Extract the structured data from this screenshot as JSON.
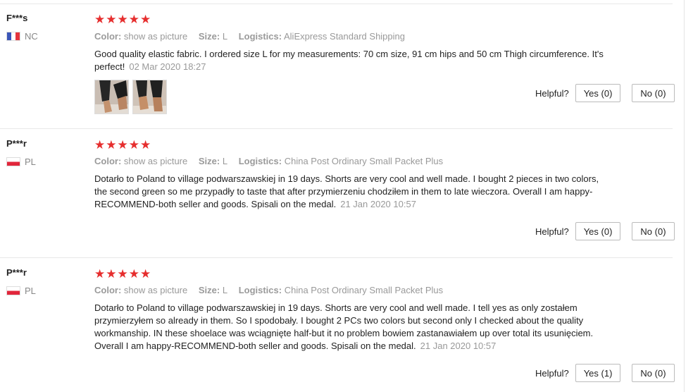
{
  "reviews": [
    {
      "user": "F***s",
      "country": "NC",
      "rating_stars": 5,
      "stars": "★★★★★",
      "color_label": "Color:",
      "color_value": "show as picture",
      "size_label": "Size:",
      "size_value": "L",
      "logistics_label": "Logistics:",
      "logistics_value": "AliExpress Standard Shipping",
      "text": "Good quality elastic fabric. I ordered size L for my measurements: 70 cm size, 91 cm hips and 50 cm Thigh circumference. It's perfect!",
      "date": "02 Mar 2020 18:27",
      "helpful_label": "Helpful?",
      "yes_label": "Yes (0)",
      "no_label": "No (0)"
    },
    {
      "user": "P***r",
      "country": "PL",
      "rating_stars": 5,
      "stars": "★★★★★",
      "color_label": "Color:",
      "color_value": "show as picture",
      "size_label": "Size:",
      "size_value": "L",
      "logistics_label": "Logistics:",
      "logistics_value": "China Post Ordinary Small Packet Plus",
      "text": "Dotarło to Poland to village podwarszawskiej in 19 days. Shorts are very cool and well made. I bought 2 pieces in two colors, the second green so me przypadły to taste that after przymierzeniu chodziłem in them to late wieczora. Overall I am happy-RECOMMEND-both seller and goods. Spisali on the medal.",
      "date": "21 Jan 2020 10:57",
      "helpful_label": "Helpful?",
      "yes_label": "Yes (0)",
      "no_label": "No (0)"
    },
    {
      "user": "P***r",
      "country": "PL",
      "rating_stars": 5,
      "stars": "★★★★★",
      "color_label": "Color:",
      "color_value": "show as picture",
      "size_label": "Size:",
      "size_value": "L",
      "logistics_label": "Logistics:",
      "logistics_value": "China Post Ordinary Small Packet Plus",
      "text": "Dotarło to Poland to village podwarszawskiej in 19 days. Shorts are very cool and well made. I tell yes as only zostałem przymierzyłem so already in them. So I spodobały. I bought 2 PCs two colors but second only I checked about the quality workmanship. IN these shoelace was wciągnięte half-but it no problem bowiem zastanawiałem up over total its usunięciem. Overall I am happy-RECOMMEND-both seller and goods. Spisali on the medal.",
      "date": "21 Jan 2020 10:57",
      "helpful_label": "Helpful?",
      "yes_label": "Yes (1)",
      "no_label": "No (0)"
    }
  ]
}
